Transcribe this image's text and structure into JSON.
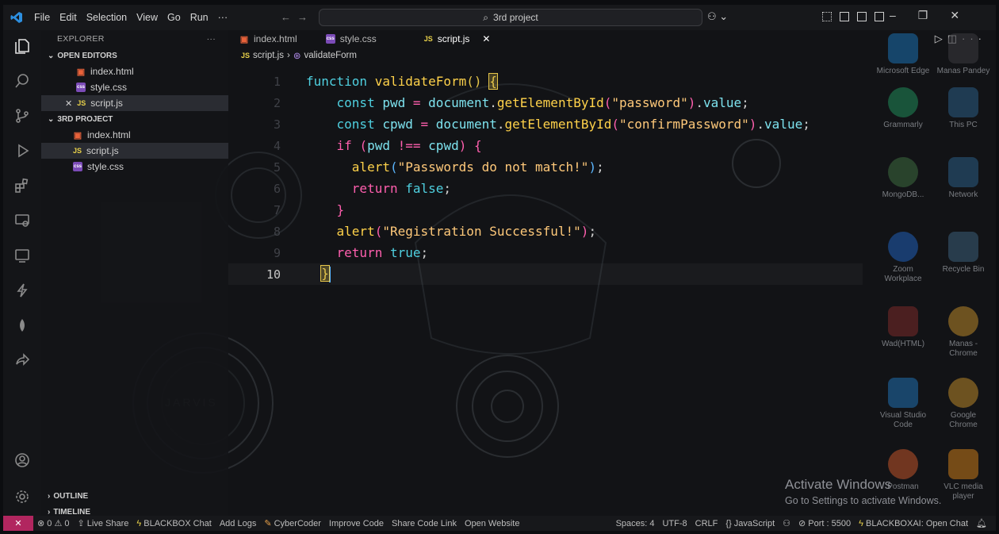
{
  "titlebar": {
    "menu": [
      "File",
      "Edit",
      "Selection",
      "View",
      "Go",
      "Run",
      "···"
    ],
    "search": "3rd project"
  },
  "explorer": {
    "header": "EXPLORER",
    "header_more": "···",
    "open_editors_label": "OPEN EDITORS",
    "open_editors": [
      {
        "name": "index.html",
        "type": "html"
      },
      {
        "name": "style.css",
        "type": "css"
      },
      {
        "name": "script.js",
        "type": "js",
        "active": true
      }
    ],
    "project_label": "3RD PROJECT",
    "project_files": [
      {
        "name": "index.html",
        "type": "html"
      },
      {
        "name": "script.js",
        "type": "js",
        "selected": true
      },
      {
        "name": "style.css",
        "type": "css"
      }
    ],
    "outline_label": "OUTLINE",
    "timeline_label": "TIMELINE"
  },
  "tabs": [
    {
      "label": "index.html",
      "type": "html"
    },
    {
      "label": "style.css",
      "type": "css"
    },
    {
      "label": "script.js",
      "type": "js",
      "active": true
    }
  ],
  "breadcrumb": {
    "file": "script.js",
    "symbol": "validateForm"
  },
  "editor": {
    "line_numbers": [
      "1",
      "2",
      "3",
      "4",
      "5",
      "6",
      "7",
      "8",
      "9",
      "10"
    ],
    "current_line": "10",
    "lines": [
      "function validateForm() {",
      "    const pwd = document.getElementById(\"password\").value;",
      "    const cpwd = document.getElementById(\"confirmPassword\").value;",
      "    if (pwd !== cpwd) {",
      "      alert(\"Passwords do not match!\");",
      "      return false;",
      "    }",
      "    alert(\"Registration Successful!\");",
      "    return true;",
      "}"
    ]
  },
  "wallpaper": {
    "jarvis": "JARVIS"
  },
  "desktop_icons": [
    {
      "label": "Microsoft Edge"
    },
    {
      "label": "Manas Pandey"
    },
    {
      "label": "Grammarly"
    },
    {
      "label": "This PC"
    },
    {
      "label": "MongoDB..."
    },
    {
      "label": "Network"
    },
    {
      "label": "Zoom Workplace"
    },
    {
      "label": "Recycle Bin"
    },
    {
      "label": "Wad(HTML)"
    },
    {
      "label": "Manas - Chrome"
    },
    {
      "label": "Visual Studio Code"
    },
    {
      "label": "Google Chrome"
    },
    {
      "label": "Postman"
    },
    {
      "label": "VLC media player"
    }
  ],
  "watermark": {
    "line1": "Activate Windows",
    "line2": "Go to Settings to activate Windows."
  },
  "statusbar": {
    "left": [
      "⊗ 0 ⚠ 0",
      "Live Share",
      "BLACKBOX Chat",
      "Add Logs",
      "CyberCoder",
      "Improve Code",
      "Share Code Link",
      "Open Website"
    ],
    "right": [
      "Spaces: 4",
      "UTF-8",
      "CRLF",
      "{} JavaScript",
      "⊘ Port : 5500",
      "BLACKBOXAI: Open Chat"
    ]
  },
  "colors": {
    "keyword": "#4fd0e0",
    "function": "#ffd24a",
    "string": "#ffc97a",
    "operator": "#ff5fae",
    "remote": "#b1265f"
  }
}
